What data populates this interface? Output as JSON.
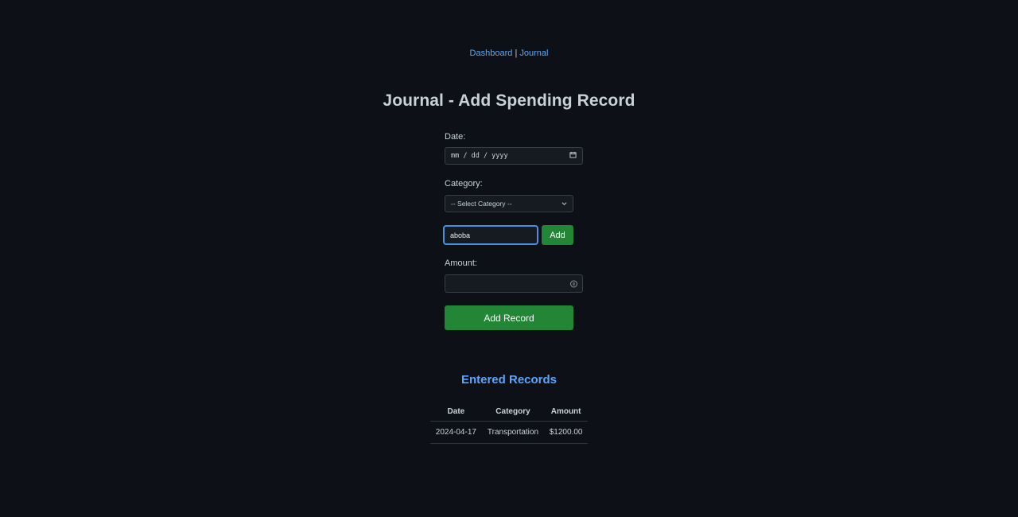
{
  "nav": {
    "dashboard": "Dashboard",
    "separator": "|",
    "journal": "Journal"
  },
  "page_title": "Journal - Add Spending Record",
  "form": {
    "date_label": "Date:",
    "date_placeholder": "mm / dd / yyyy",
    "category_label": "Category:",
    "category_selected": "-- Select Category --",
    "new_category_value": "aboba",
    "add_category_button": "Add",
    "amount_label": "Amount:",
    "amount_value": "",
    "submit_button": "Add Record"
  },
  "records": {
    "title": "Entered Records",
    "columns": [
      "Date",
      "Category",
      "Amount"
    ],
    "rows": [
      {
        "date": "2024-04-17",
        "category": "Transportation",
        "amount": "$1200.00"
      }
    ]
  },
  "colors": {
    "background": "#0d1117",
    "link": "#58a6ff",
    "button": "#238636",
    "focus_border": "#4a8fe0"
  },
  "icons": {
    "date_field": "calendar-icon",
    "select_field": "chevron-down-icon",
    "amount_field": "number-stepper-icon"
  }
}
